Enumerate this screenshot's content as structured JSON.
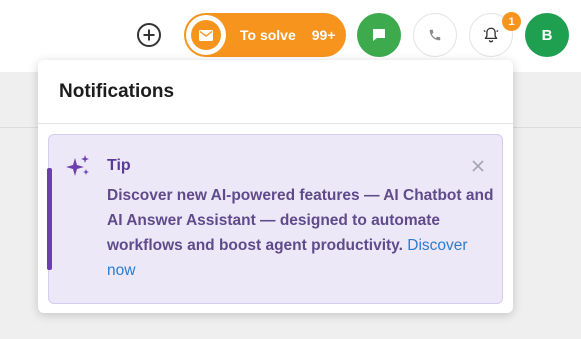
{
  "header": {
    "solve_label": "To solve",
    "solve_count": "99+",
    "bell_badge": "1",
    "avatar_initial": "B",
    "colors": {
      "solve_orange": "#f7941d",
      "chat_green": "#3daa4e",
      "avatar_green": "#1ea050",
      "badge_orange": "#f7941d"
    },
    "icons": [
      "add-circle-icon",
      "envelope-icon",
      "chat-icon",
      "phone-icon",
      "bell-icon"
    ]
  },
  "notifications": {
    "title": "Notifications",
    "tip": {
      "title": "Tip",
      "icon": "sparkle-icon",
      "body_text": "Discover new AI-powered features — AI Chatbot and AI Answer Assistant — designed to automate workflows and boost agent productivity. ",
      "link_text": "Discover now",
      "accent_color": "#6b3fb0",
      "background_color": "#ede8f7"
    }
  }
}
